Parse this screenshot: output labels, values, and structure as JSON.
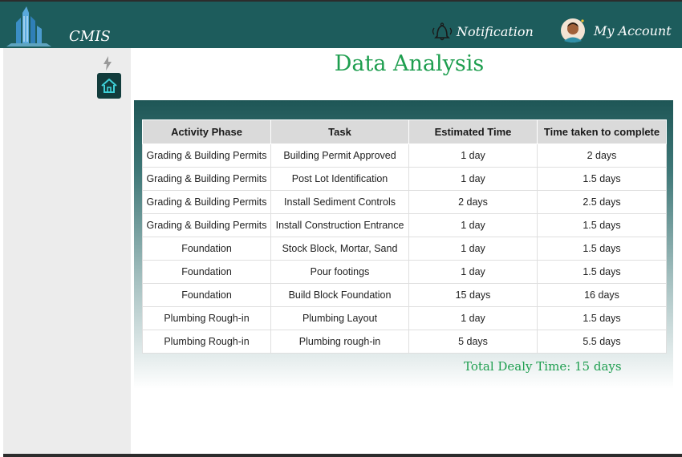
{
  "header": {
    "brand": "CMIS",
    "notification_label": "Notification",
    "account_label": "My Account",
    "logo_icon": "city-skyline-icon",
    "notification_icon": "bell-icon",
    "account_icon": "user-avatar-icon"
  },
  "sidebar": {
    "icons": [
      "lightning-icon",
      "home-icon"
    ]
  },
  "main": {
    "title": "Data Analysis",
    "table": {
      "headers": [
        "Activity Phase",
        "Task",
        "Estimated Time",
        "Time taken to complete"
      ],
      "rows": [
        [
          "Grading & Building Permits",
          "Building Permit Approved",
          "1 day",
          "2 days"
        ],
        [
          "Grading & Building Permits",
          "Post Lot Identification",
          "1 day",
          "1.5 days"
        ],
        [
          "Grading & Building Permits",
          "Install Sediment Controls",
          "2 days",
          "2.5 days"
        ],
        [
          "Grading & Building Permits",
          "Install Construction Entrance",
          "1 day",
          "1.5 days"
        ],
        [
          "Foundation",
          "Stock Block, Mortar, Sand",
          "1 day",
          "1.5 days"
        ],
        [
          "Foundation",
          "Pour footings",
          "1 day",
          "1.5 days"
        ],
        [
          "Foundation",
          "Build Block Foundation",
          "15 days",
          "16 days"
        ],
        [
          "Plumbing Rough-in",
          "Plumbing Layout",
          "1 day",
          "1.5 days"
        ],
        [
          "Plumbing Rough-in",
          "Plumbing rough-in",
          "5 days",
          "5.5 days"
        ]
      ]
    },
    "total": "Total Dealy Time: 15 days"
  },
  "colors": {
    "header_bg": "#1d5c5c",
    "accent_green": "#1e9e4f",
    "sidebar_bg": "#ececec"
  }
}
